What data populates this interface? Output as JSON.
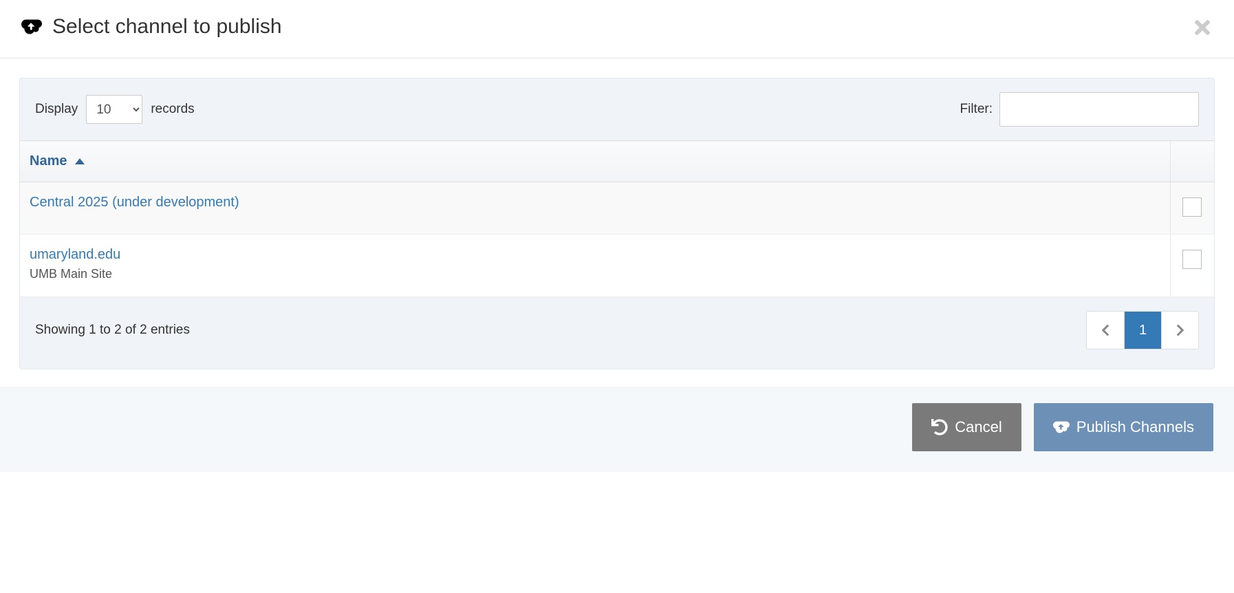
{
  "modal_title": "Select channel to publish",
  "controls": {
    "display_label": "Display",
    "display_value": "10",
    "records_label": "records",
    "filter_label": "Filter:",
    "filter_value": ""
  },
  "table": {
    "header_name": "Name",
    "rows": [
      {
        "name": "Central 2025 (under development)",
        "sub": ""
      },
      {
        "name": "umaryland.edu",
        "sub": "UMB Main Site"
      }
    ]
  },
  "footer_info": "Showing 1 to 2 of 2 entries",
  "pagination": {
    "current": "1"
  },
  "buttons": {
    "cancel": "Cancel",
    "publish": "Publish Channels"
  }
}
